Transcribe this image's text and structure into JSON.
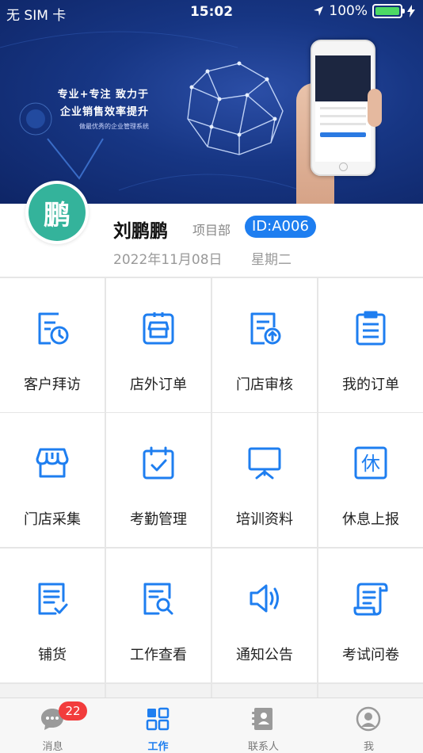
{
  "status_bar": {
    "carrier": "无 SIM 卡",
    "time": "15:02",
    "battery": "100%"
  },
  "banner": {
    "line1": "专业+专注 致力于",
    "line2": "企业销售效率提升",
    "line3": "做最优秀的企业管理系统"
  },
  "profile": {
    "avatar_char": "鹏",
    "name": "刘鹏鹏",
    "department": "项目部",
    "id": "ID:A006",
    "date": "2022年11月08日",
    "weekday": "星期二"
  },
  "grid": [
    {
      "label": "客户拜访",
      "icon": "visit-clock-icon"
    },
    {
      "label": "店外订单",
      "icon": "store-order-icon"
    },
    {
      "label": "门店审核",
      "icon": "store-review-icon"
    },
    {
      "label": "我的订单",
      "icon": "my-orders-icon"
    },
    {
      "label": "门店采集",
      "icon": "store-awning-icon"
    },
    {
      "label": "考勤管理",
      "icon": "attendance-calendar-icon"
    },
    {
      "label": "培训资料",
      "icon": "training-board-icon"
    },
    {
      "label": "休息上报",
      "icon": "rest-report-icon",
      "icon_char": "休"
    },
    {
      "label": "铺货",
      "icon": "stocking-list-icon"
    },
    {
      "label": "工作查看",
      "icon": "work-view-search-icon"
    },
    {
      "label": "通知公告",
      "icon": "speaker-icon"
    },
    {
      "label": "考试问卷",
      "icon": "exam-scroll-icon"
    }
  ],
  "tabbar": {
    "items": [
      {
        "label": "消息",
        "icon": "chat-bubble-icon",
        "badge": "22"
      },
      {
        "label": "工作",
        "icon": "grid-apps-icon",
        "active": true
      },
      {
        "label": "联系人",
        "icon": "contacts-book-icon"
      },
      {
        "label": "我",
        "icon": "user-profile-icon"
      }
    ]
  },
  "colors": {
    "accent": "#1e7ef0",
    "avatar": "#34b39b",
    "badge": "#f23c3c",
    "banner": "#173684"
  }
}
